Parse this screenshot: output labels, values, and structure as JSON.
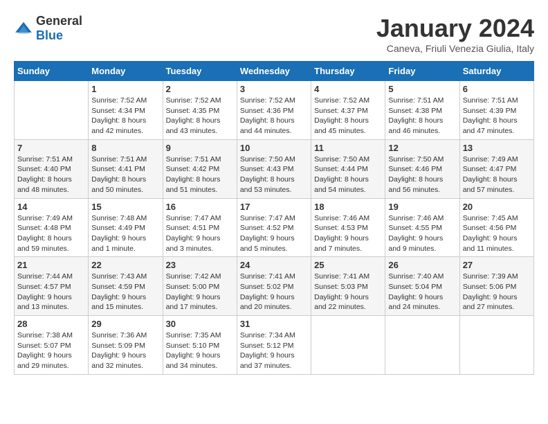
{
  "logo": {
    "general": "General",
    "blue": "Blue"
  },
  "title": "January 2024",
  "subtitle": "Caneva, Friuli Venezia Giulia, Italy",
  "days_of_week": [
    "Sunday",
    "Monday",
    "Tuesday",
    "Wednesday",
    "Thursday",
    "Friday",
    "Saturday"
  ],
  "weeks": [
    [
      {
        "day": "",
        "detail": ""
      },
      {
        "day": "1",
        "detail": "Sunrise: 7:52 AM\nSunset: 4:34 PM\nDaylight: 8 hours\nand 42 minutes."
      },
      {
        "day": "2",
        "detail": "Sunrise: 7:52 AM\nSunset: 4:35 PM\nDaylight: 8 hours\nand 43 minutes."
      },
      {
        "day": "3",
        "detail": "Sunrise: 7:52 AM\nSunset: 4:36 PM\nDaylight: 8 hours\nand 44 minutes."
      },
      {
        "day": "4",
        "detail": "Sunrise: 7:52 AM\nSunset: 4:37 PM\nDaylight: 8 hours\nand 45 minutes."
      },
      {
        "day": "5",
        "detail": "Sunrise: 7:51 AM\nSunset: 4:38 PM\nDaylight: 8 hours\nand 46 minutes."
      },
      {
        "day": "6",
        "detail": "Sunrise: 7:51 AM\nSunset: 4:39 PM\nDaylight: 8 hours\nand 47 minutes."
      }
    ],
    [
      {
        "day": "7",
        "detail": "Sunrise: 7:51 AM\nSunset: 4:40 PM\nDaylight: 8 hours\nand 48 minutes."
      },
      {
        "day": "8",
        "detail": "Sunrise: 7:51 AM\nSunset: 4:41 PM\nDaylight: 8 hours\nand 50 minutes."
      },
      {
        "day": "9",
        "detail": "Sunrise: 7:51 AM\nSunset: 4:42 PM\nDaylight: 8 hours\nand 51 minutes."
      },
      {
        "day": "10",
        "detail": "Sunrise: 7:50 AM\nSunset: 4:43 PM\nDaylight: 8 hours\nand 53 minutes."
      },
      {
        "day": "11",
        "detail": "Sunrise: 7:50 AM\nSunset: 4:44 PM\nDaylight: 8 hours\nand 54 minutes."
      },
      {
        "day": "12",
        "detail": "Sunrise: 7:50 AM\nSunset: 4:46 PM\nDaylight: 8 hours\nand 56 minutes."
      },
      {
        "day": "13",
        "detail": "Sunrise: 7:49 AM\nSunset: 4:47 PM\nDaylight: 8 hours\nand 57 minutes."
      }
    ],
    [
      {
        "day": "14",
        "detail": "Sunrise: 7:49 AM\nSunset: 4:48 PM\nDaylight: 8 hours\nand 59 minutes."
      },
      {
        "day": "15",
        "detail": "Sunrise: 7:48 AM\nSunset: 4:49 PM\nDaylight: 9 hours\nand 1 minute."
      },
      {
        "day": "16",
        "detail": "Sunrise: 7:47 AM\nSunset: 4:51 PM\nDaylight: 9 hours\nand 3 minutes."
      },
      {
        "day": "17",
        "detail": "Sunrise: 7:47 AM\nSunset: 4:52 PM\nDaylight: 9 hours\nand 5 minutes."
      },
      {
        "day": "18",
        "detail": "Sunrise: 7:46 AM\nSunset: 4:53 PM\nDaylight: 9 hours\nand 7 minutes."
      },
      {
        "day": "19",
        "detail": "Sunrise: 7:46 AM\nSunset: 4:55 PM\nDaylight: 9 hours\nand 9 minutes."
      },
      {
        "day": "20",
        "detail": "Sunrise: 7:45 AM\nSunset: 4:56 PM\nDaylight: 9 hours\nand 11 minutes."
      }
    ],
    [
      {
        "day": "21",
        "detail": "Sunrise: 7:44 AM\nSunset: 4:57 PM\nDaylight: 9 hours\nand 13 minutes."
      },
      {
        "day": "22",
        "detail": "Sunrise: 7:43 AM\nSunset: 4:59 PM\nDaylight: 9 hours\nand 15 minutes."
      },
      {
        "day": "23",
        "detail": "Sunrise: 7:42 AM\nSunset: 5:00 PM\nDaylight: 9 hours\nand 17 minutes."
      },
      {
        "day": "24",
        "detail": "Sunrise: 7:41 AM\nSunset: 5:02 PM\nDaylight: 9 hours\nand 20 minutes."
      },
      {
        "day": "25",
        "detail": "Sunrise: 7:41 AM\nSunset: 5:03 PM\nDaylight: 9 hours\nand 22 minutes."
      },
      {
        "day": "26",
        "detail": "Sunrise: 7:40 AM\nSunset: 5:04 PM\nDaylight: 9 hours\nand 24 minutes."
      },
      {
        "day": "27",
        "detail": "Sunrise: 7:39 AM\nSunset: 5:06 PM\nDaylight: 9 hours\nand 27 minutes."
      }
    ],
    [
      {
        "day": "28",
        "detail": "Sunrise: 7:38 AM\nSunset: 5:07 PM\nDaylight: 9 hours\nand 29 minutes."
      },
      {
        "day": "29",
        "detail": "Sunrise: 7:36 AM\nSunset: 5:09 PM\nDaylight: 9 hours\nand 32 minutes."
      },
      {
        "day": "30",
        "detail": "Sunrise: 7:35 AM\nSunset: 5:10 PM\nDaylight: 9 hours\nand 34 minutes."
      },
      {
        "day": "31",
        "detail": "Sunrise: 7:34 AM\nSunset: 5:12 PM\nDaylight: 9 hours\nand 37 minutes."
      },
      {
        "day": "",
        "detail": ""
      },
      {
        "day": "",
        "detail": ""
      },
      {
        "day": "",
        "detail": ""
      }
    ]
  ]
}
